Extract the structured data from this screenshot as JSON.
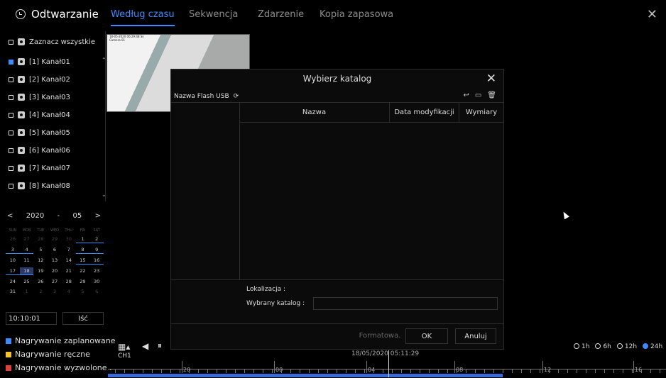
{
  "header": {
    "title": "Odtwarzanie",
    "tabs": [
      {
        "label": "Według czasu",
        "active": true
      },
      {
        "label": "Sekwencja"
      },
      {
        "label": "Zdarzenie"
      },
      {
        "label": "Kopia zapasowa"
      }
    ],
    "close_icon": "close-icon"
  },
  "sidebar": {
    "select_all": "Zaznacz wszystkie",
    "channels": [
      {
        "label": "[1] Kanał01",
        "checked": true
      },
      {
        "label": "[2] Kanał02",
        "checked": false
      },
      {
        "label": "[3] Kanał03",
        "checked": false
      },
      {
        "label": "[4] Kanał04",
        "checked": false
      },
      {
        "label": "[5] Kanał05",
        "checked": false
      },
      {
        "label": "[6] Kanał06",
        "checked": false
      },
      {
        "label": "[7] Kanał07",
        "checked": false
      },
      {
        "label": "[8] Kanał08",
        "checked": false
      }
    ],
    "calendar": {
      "prev": "<",
      "year": "2020",
      "sep": "-",
      "month": "05",
      "next": ">",
      "weekdays": [
        "SUN",
        "MON",
        "TUE",
        "WED",
        "THU",
        "FRI",
        "SAT"
      ],
      "days": [
        [
          "26",
          "27",
          "28",
          "29",
          "30",
          "1",
          "2"
        ],
        [
          "3",
          "4",
          "5",
          "6",
          "7",
          "8",
          "9"
        ],
        [
          "10",
          "11",
          "12",
          "13",
          "14",
          "15",
          "16"
        ],
        [
          "17",
          "18",
          "19",
          "20",
          "21",
          "22",
          "23"
        ],
        [
          "24",
          "25",
          "26",
          "27",
          "28",
          "29",
          "30"
        ],
        [
          "31",
          "1",
          "2",
          "3",
          "4",
          "5",
          "6"
        ]
      ],
      "selected": "18"
    },
    "time": "10:10:01",
    "go": "Iść",
    "legend": [
      {
        "label": "Nagrywanie zaplanowane",
        "color": "#3d8bff",
        "type": "check"
      },
      {
        "label": "Nagrywanie ręczne",
        "color": "#f2c232"
      },
      {
        "label": "Nagrywanie wyzwolone .",
        "color": "#e04040",
        "type": "check"
      }
    ]
  },
  "video": {
    "overlay": "18-05-2020 06:29:48 Sn",
    "cam": "Camera 01"
  },
  "dialog": {
    "title": "Wybierz katalog",
    "device": "Nazwa Flash USB",
    "columns": [
      "Nazwa",
      "Data modyfikacji",
      "Wymiary"
    ],
    "location_label": "Lokalizacja :",
    "dir_label": "Wybrany katalog :",
    "format": "Formatowa.",
    "ok": "OK",
    "cancel": "Anuluj"
  },
  "timeline": {
    "channel": "CH1",
    "current": "18/05/2020 05:11:29",
    "labels": [
      "20",
      "00",
      "04",
      "08",
      "12",
      "16"
    ],
    "ranges": [
      {
        "label": "1h"
      },
      {
        "label": "6h"
      },
      {
        "label": "12h"
      },
      {
        "label": "24h",
        "active": true
      }
    ]
  }
}
